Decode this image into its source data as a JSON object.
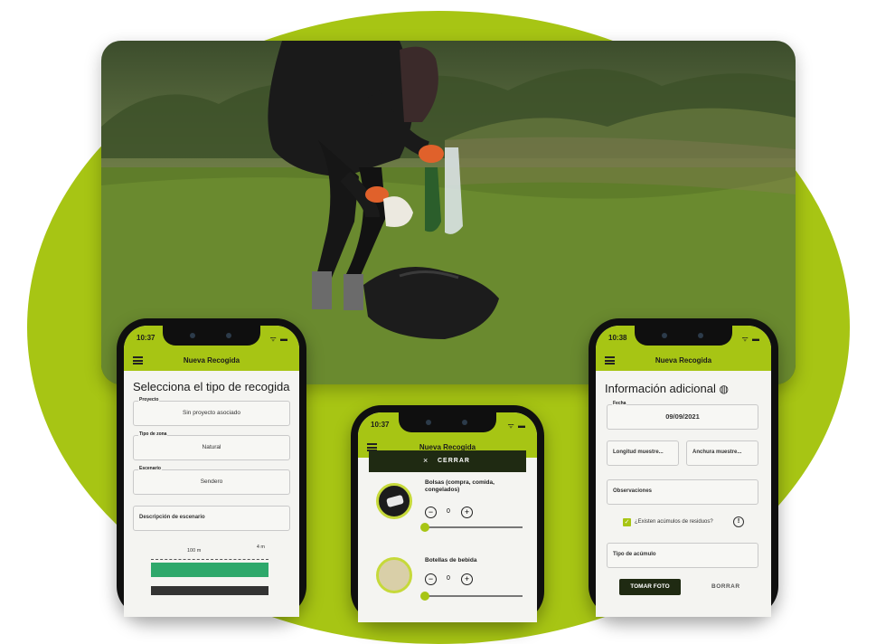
{
  "phone_left": {
    "time": "10:37",
    "app_title": "Nueva Recogida",
    "heading": "Selecciona el tipo de recogida",
    "fields": [
      {
        "label": "Proyecto",
        "value": "Sin proyecto asociado"
      },
      {
        "label": "Tipo de zona",
        "value": "Natural"
      },
      {
        "label": "Escenario",
        "value": "Sendero"
      },
      {
        "label": "",
        "value": "Descripción de escenario"
      }
    ],
    "scale_left": "100 m",
    "scale_right": "4 m"
  },
  "phone_middle": {
    "time": "10:37",
    "app_title": "Nueva Recogida",
    "close_label": "CERRAR",
    "items": [
      {
        "name": "Bolsas (compra, comida, congelados)",
        "count": "0"
      },
      {
        "name": "Botellas de bebida",
        "count": "0"
      }
    ]
  },
  "phone_right": {
    "time": "10:38",
    "app_title": "Nueva Recogida",
    "heading": "Información adicional",
    "date_label": "Fecha",
    "date_value": "09/09/2021",
    "length_label": "Longitud muestre...",
    "width_label": "Anchura muestre...",
    "observations_label": "Observaciones",
    "checkbox_label": "¿Existen acúmulos de residuos?",
    "accumulation_label": "Tipo de acúmulo",
    "photo_button": "TOMAR FOTO",
    "delete_button": "BORRAR"
  },
  "colors": {
    "accent": "#a7c514",
    "dark": "#1f2a12",
    "background": "#ffffff"
  }
}
